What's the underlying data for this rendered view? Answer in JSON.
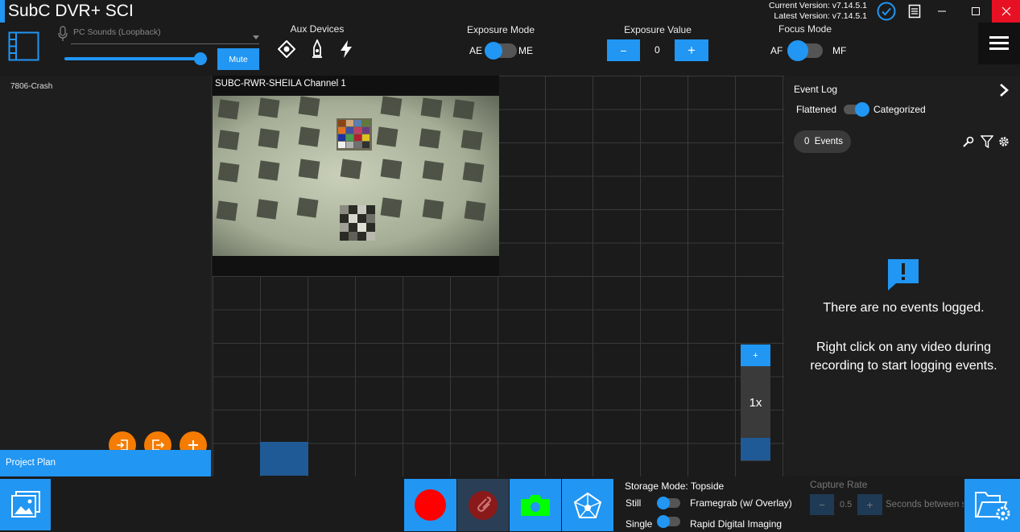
{
  "app": {
    "title": "SubC DVR+ SCI"
  },
  "version": {
    "current": "Current Version: v7.14.5.1",
    "latest": "Latest Version: v7.14.5.1"
  },
  "audio": {
    "source": "PC Sounds (Loopback)",
    "mute_label": "Mute",
    "volume": 0.95
  },
  "aux": {
    "label": "Aux Devices"
  },
  "exposure_mode": {
    "label": "Exposure Mode",
    "left": "AE",
    "right": "ME",
    "state": "AE"
  },
  "exposure_value": {
    "label": "Exposure Value",
    "minus": "−",
    "value": "0",
    "plus": "+"
  },
  "focus_mode": {
    "label": "Focus Mode",
    "left": "AF",
    "right": "MF",
    "state": "AF"
  },
  "left_panel": {
    "items": [
      "7806-Crash"
    ],
    "project_plan": "Project Plan"
  },
  "channel": {
    "title": "SUBC-RWR-SHEILA Channel 1"
  },
  "zoom": {
    "plus": "+",
    "level": "1x"
  },
  "event_log": {
    "title": "Event Log",
    "flattened": "Flattened",
    "categorized": "Categorized",
    "events_count": "0  Events",
    "empty_title": "There are no events logged.",
    "empty_hint": "Right click on any video during recording to start logging events."
  },
  "storage": {
    "mode": "Storage Mode: Topside",
    "still": "Still",
    "framegrab": "Framegrab (w/ Overlay)",
    "single": "Single",
    "rdi": "Rapid Digital Imaging"
  },
  "capture_rate": {
    "label": "Capture Rate",
    "minus": "−",
    "value": "0.5",
    "plus": "+",
    "unit": "Seconds between s"
  },
  "colors": {
    "accent": "#2196f3",
    "orange": "#f57c00",
    "record": "#ff0000",
    "green": "#00ff00"
  }
}
